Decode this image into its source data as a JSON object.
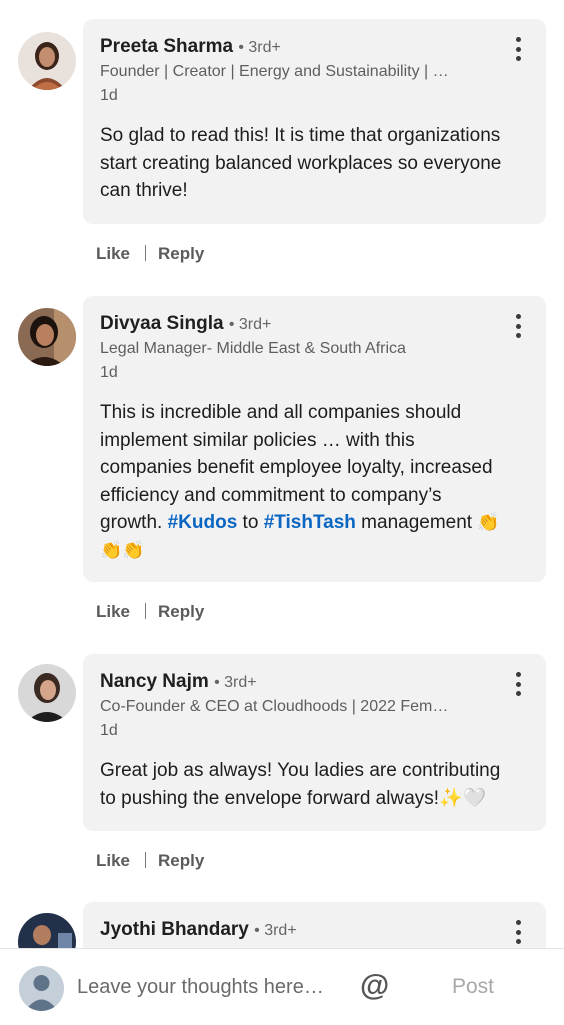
{
  "comments": [
    {
      "name": "Preeta Sharma",
      "degree": "• 3rd+",
      "headline": "Founder | Creator | Energy and Sustainability | …",
      "time": "1d",
      "text": "So glad to read this! It is time that organizations start creating balanced workplaces so everyone can thrive!",
      "like": "Like",
      "reply": "Reply"
    },
    {
      "name": "Divyaa Singla",
      "degree": "• 3rd+",
      "headline": "Legal Manager- Middle East & South Africa",
      "time": "1d",
      "text_part1": "This is incredible and all companies should implement similar policies … with this companies benefit employee loyalty, increased efficiency and commitment to company’s growth. ",
      "tag1": "#Kudos",
      "text_part2": " to ",
      "tag2": "#TishTash",
      "text_part3": " management ",
      "emoji": "👏",
      "emoji_line2": "👏👏",
      "like": "Like",
      "reply": "Reply"
    },
    {
      "name": "Nancy Najm",
      "degree": "• 3rd+",
      "headline": "Co-Founder & CEO at Cloudhoods | 2022 Fem…",
      "time": "1d",
      "text": "Great job as always! You ladies are contributing to pushing the envelope forward always!✨🤍",
      "like": "Like",
      "reply": "Reply"
    },
    {
      "name": "Jyothi Bhandary",
      "degree": "• 3rd+"
    }
  ],
  "composer": {
    "placeholder": "Leave your thoughts here…",
    "mention": "@",
    "post": "Post"
  },
  "colors": {
    "bubble": "#f2f2f2",
    "hashtag": "#0a66c2",
    "post_disabled": "#a8a8a8"
  }
}
